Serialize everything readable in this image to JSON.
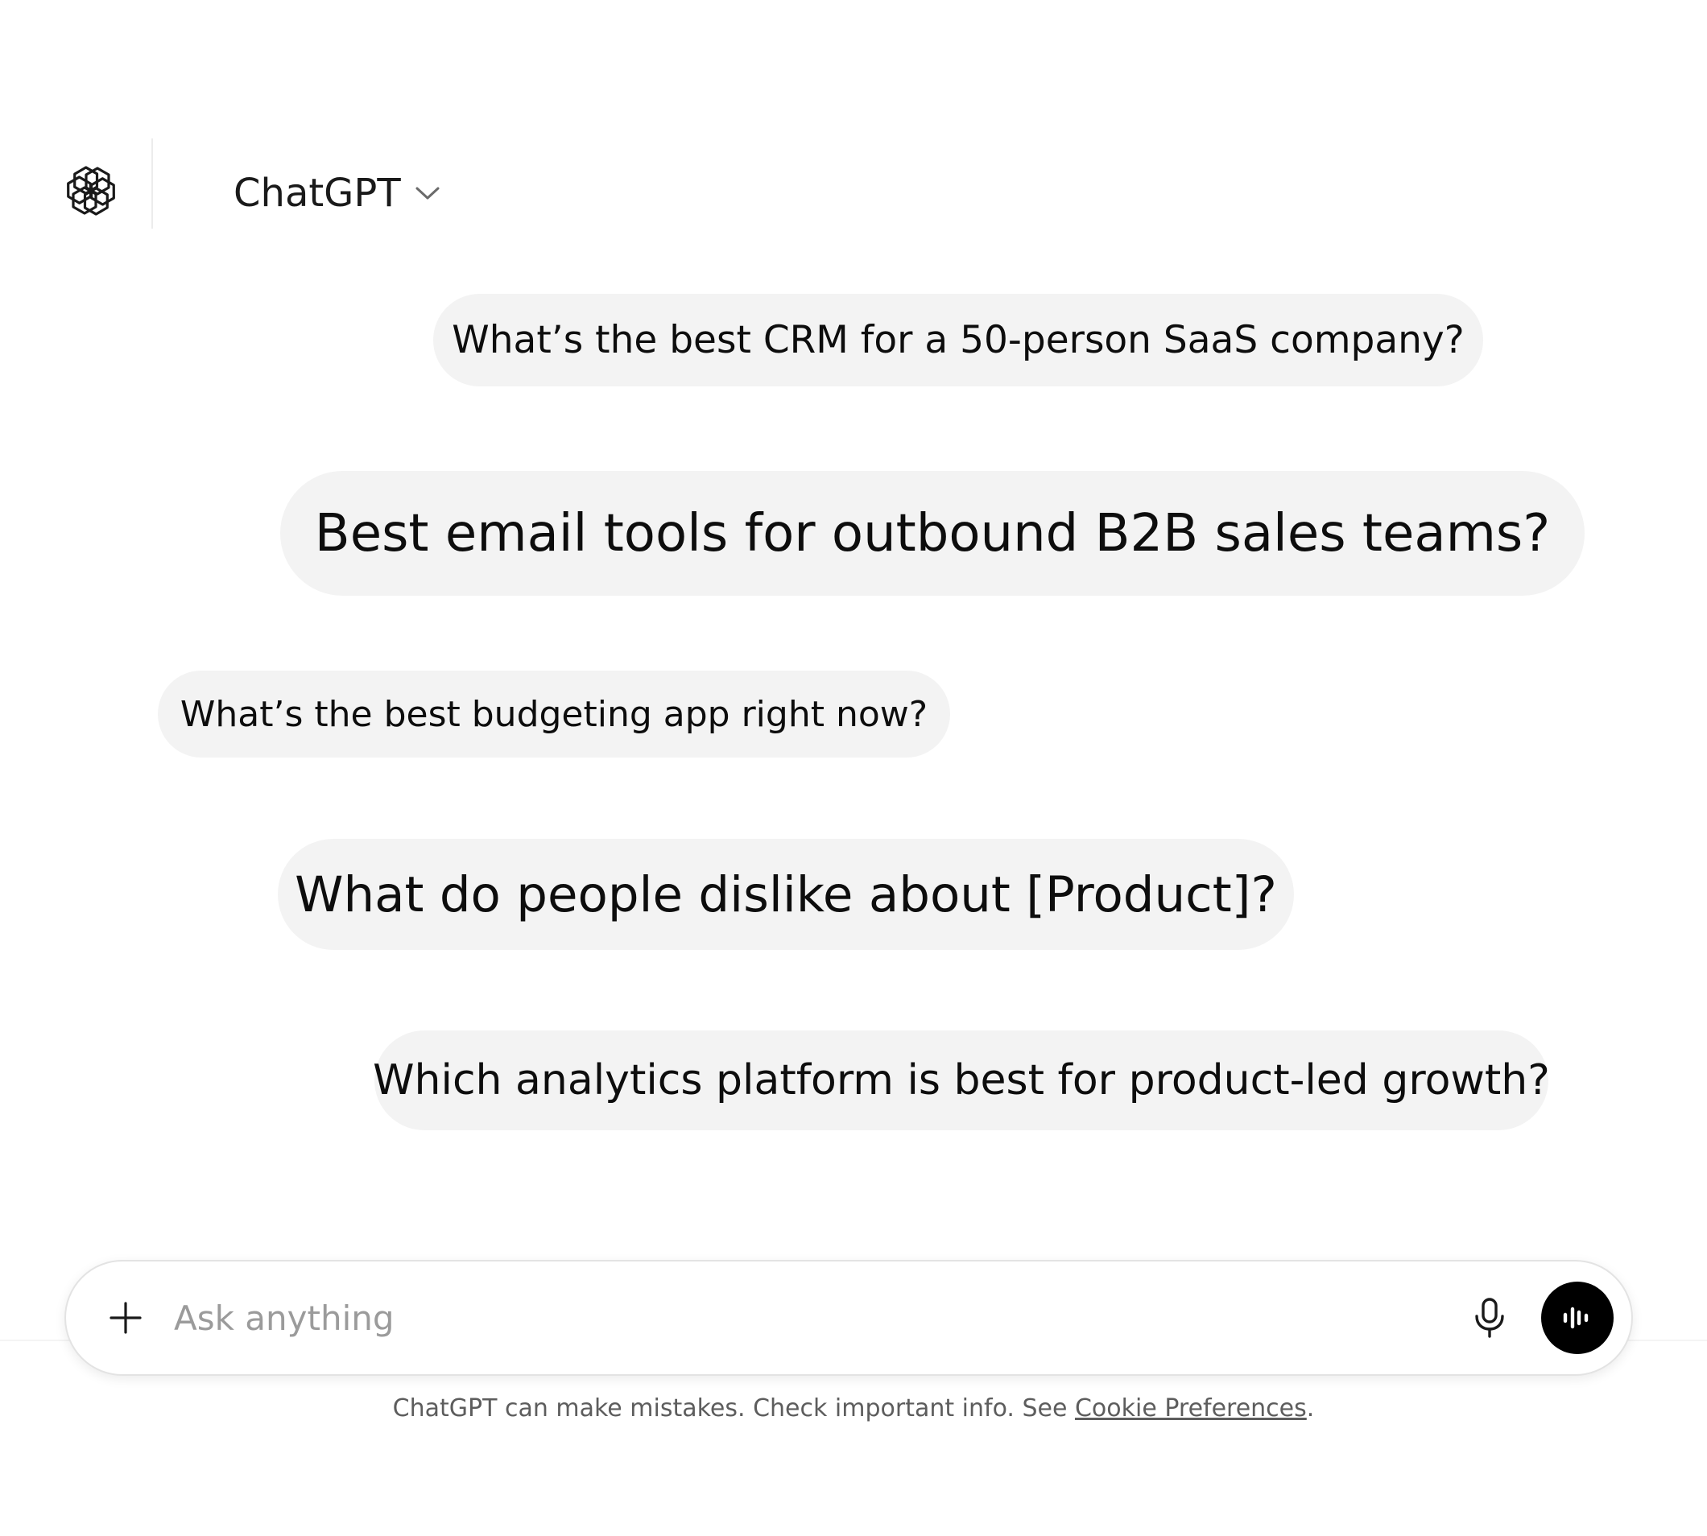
{
  "header": {
    "logo_icon": "openai-logo-icon",
    "model_name": "ChatGPT",
    "model_dropdown_icon": "chevron-down-icon"
  },
  "messages": [
    {
      "text": "What’s the best CRM for a 50-person SaaS company?"
    },
    {
      "text": "Best email tools for outbound B2B sales teams?"
    },
    {
      "text": "What’s the best budgeting app right now?"
    },
    {
      "text": "What do people dislike about [Product]?"
    },
    {
      "text": "Which analytics platform is best for product-led growth?"
    }
  ],
  "composer": {
    "placeholder": "Ask anything",
    "value": "",
    "attach_icon": "plus-icon",
    "mic_icon": "microphone-icon",
    "voice_icon": "voice-mode-icon"
  },
  "footer": {
    "disclaimer_text": "ChatGPT can make mistakes. Check important info. See ",
    "link_text": "Cookie Preferences",
    "trailing": "."
  },
  "colors": {
    "bubble_bg": "#f3f3f3",
    "text": "#0d0d0d",
    "muted": "#5d5d5d",
    "voice_button_bg": "#000000"
  }
}
